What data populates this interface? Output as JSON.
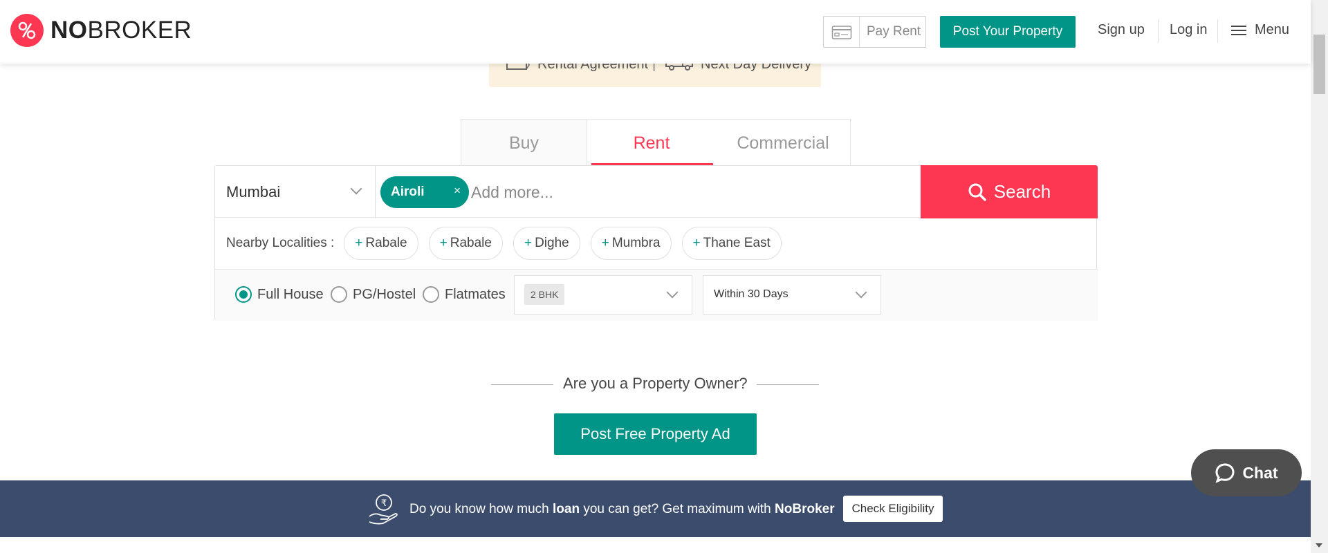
{
  "header": {
    "logo": "NOBROKER",
    "logo_bold": "NO",
    "logo_rest": "BROKER",
    "pay_rent": "Pay Rent",
    "post_property": "Post Your Property",
    "sign_up": "Sign up",
    "log_in": "Log in",
    "menu": "Menu"
  },
  "promo": {
    "item1": "Rental Agreement",
    "separator": "|",
    "item2": "Next Day Delivery"
  },
  "tabs": [
    {
      "label": "Buy",
      "active": false
    },
    {
      "label": "Rent",
      "active": true
    },
    {
      "label": "Commercial",
      "active": false
    }
  ],
  "search": {
    "city": "Mumbai",
    "selected_locality": "Airoli",
    "chip_remove": "×",
    "placeholder": "Add more...",
    "button": "Search"
  },
  "nearby": {
    "label": "Nearby Localities :",
    "plus": "+",
    "items": [
      "Rabale",
      "Rabale",
      "Dighe",
      "Mumbra",
      "Thane East"
    ]
  },
  "filters": {
    "options": [
      {
        "label": "Full House",
        "checked": true
      },
      {
        "label": "PG/Hostel",
        "checked": false
      },
      {
        "label": "Flatmates",
        "checked": false
      }
    ],
    "bhk": "2 BHK",
    "availability": "Within 30 Days"
  },
  "owner": {
    "question": "Are you a Property Owner?",
    "button": "Post Free Property Ad"
  },
  "chat": {
    "label": "Chat"
  },
  "loan_banner": {
    "text1": "Do you know how much ",
    "bold1": "loan",
    "text2": " you can get? Get maximum with ",
    "bold2": "NoBroker",
    "button": "Check Eligibility"
  },
  "colors": {
    "brand_red": "#fd3752",
    "brand_teal": "#009587",
    "banner_navy": "#3b4c6c",
    "promo_bg": "#fcf1de"
  }
}
